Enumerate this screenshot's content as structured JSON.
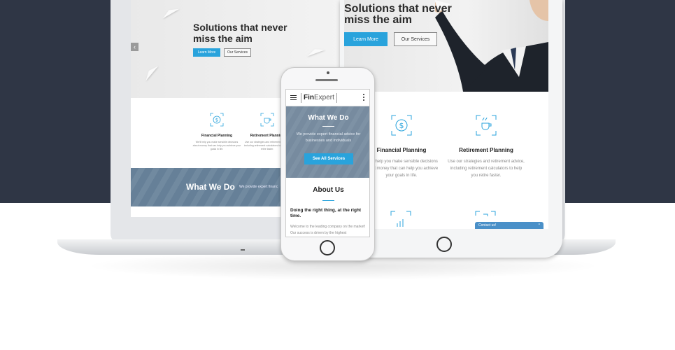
{
  "laptop": {
    "hero_title": "Solutions that never miss the aim",
    "learn_more": "Learn More",
    "our_services": "Our Services",
    "slider_arrow": "‹",
    "services": [
      {
        "title": "Financial Planning",
        "text": "We'll help you make sensible decisions about money that can help you achieve your goals in life.",
        "icon": "dollar-circle-icon"
      },
      {
        "title": "Retirement Planning",
        "text": "Use our strategies and retirement advice, including retirement calculators to help you retire faster.",
        "icon": "coffee-cup-icon"
      }
    ],
    "band_title": "What We Do",
    "band_text": "We provide expert financ"
  },
  "tablet": {
    "hero_title": "Solutions that never miss the aim",
    "learn_more": "Learn More",
    "our_services": "Our Services",
    "services": [
      {
        "title": "Financial Planning",
        "text": "We'll help you make sensible decisions about money that can help you achieve your goals in life.",
        "icon": "dollar-circle-icon"
      },
      {
        "title": "Retirement Planning",
        "text": "Use our strategies and retirement advice, including retirement calculators to help you retire faster.",
        "icon": "coffee-cup-icon"
      }
    ],
    "contact_label": "Contact us!",
    "contact_chevron": "^"
  },
  "phone": {
    "logo_bold": "Fin",
    "logo_rest": "Expert",
    "band_title": "What We Do",
    "band_text": "We provide expert financial advice for businesses and individuals",
    "band_button": "See All Services",
    "about_title": "About Us",
    "about_heading": "Doing the right thing, at the right time.",
    "about_body": "Welcome to the leading company on the market! Our success is driven by the highest"
  },
  "colors": {
    "background_dark": "#2f3645",
    "accent_blue": "#29a3dc"
  }
}
